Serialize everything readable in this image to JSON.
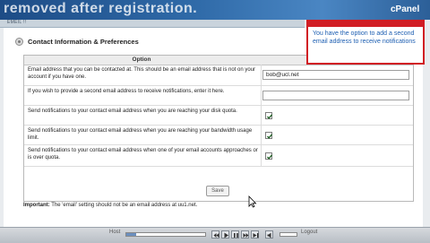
{
  "banner": {
    "watermark": "removed after registration.",
    "brand": "cPanel"
  },
  "subbar": {
    "label": "EMEIL !!"
  },
  "section": {
    "title": "Contact Information & Preferences",
    "icon": "gear-icon"
  },
  "options": {
    "header": "Option",
    "rows": [
      {
        "label": "Email address that you can be contacted at. This should be an email address that is not on your account if you have one.",
        "control": "text",
        "value": "bob@ucl.net"
      },
      {
        "label": "If you wish to provide a second email address to receive notifications, enter it here.",
        "control": "text",
        "value": ""
      },
      {
        "label": "Send notifications to your contact email address when you are reaching your disk quota.",
        "control": "checkbox",
        "checked": true
      },
      {
        "label": "Send notifications to your contact email address when you are reaching your bandwidth usage limit.",
        "control": "checkbox",
        "checked": true
      },
      {
        "label": "Send notifications to your contact email address when one of your email accounts approaches or is over quota.",
        "control": "checkbox",
        "checked": true
      }
    ]
  },
  "save_label": "Save",
  "important": {
    "prefix": "Important:",
    "text": "The 'email' setting should not be an email address at uu1.net."
  },
  "tooltip": {
    "text": "You have the option to add a second email address to receive notifications"
  },
  "player": {
    "left_label": "Host",
    "right_label": "Logout",
    "progress": 0.12
  },
  "colors": {
    "banner": "#2f6aa8",
    "tooltip_border": "#d11d24",
    "tooltip_text": "#1e5fb2"
  }
}
